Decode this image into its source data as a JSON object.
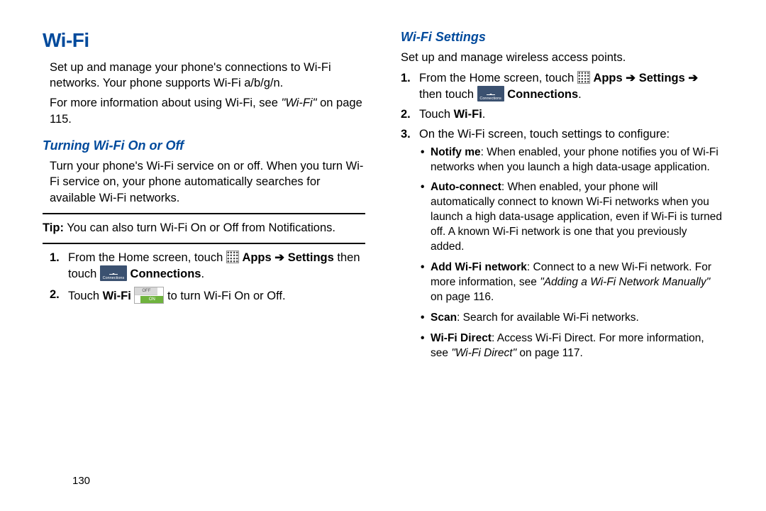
{
  "left": {
    "title": "Wi-Fi",
    "intro1": "Set up and manage your phone's connections to Wi-Fi networks. Your phone supports Wi-Fi a/b/g/n.",
    "intro2a": "For more information about using Wi-Fi, see ",
    "intro2b": "\"Wi-Fi\"",
    "intro2c": " on page 115.",
    "subhead": "Turning Wi-Fi On or Off",
    "turn_intro": "Turn your phone's Wi-Fi service on or off. When you turn Wi-Fi service on, your phone automatically searches for available Wi-Fi networks.",
    "tip_label": "Tip:",
    "tip_text": " You can also turn Wi-Fi On or Off from Notifications.",
    "step1a": "From the Home screen, touch ",
    "apps": " Apps ",
    "arrow": "➔",
    "step1b": " Settings",
    "step1c": " then touch ",
    "connections": " Connections",
    "step2a": "Touch ",
    "wifi_b": "Wi-Fi",
    "step2b": " to turn Wi-Fi On or Off.",
    "off": "OFF",
    "on": "ON"
  },
  "right": {
    "subhead": "Wi-Fi Settings",
    "intro": "Set up and manage wireless access points.",
    "step1a": "From the Home screen, touch ",
    "apps": " Apps ",
    "arrow": "➔",
    "settings": " Settings ",
    "step1b": "then touch ",
    "connections": " Connections",
    "step2a": "Touch ",
    "wifi_b": "Wi-Fi",
    "step3": "On the Wi-Fi screen, touch settings to configure:",
    "b1_label": "Notify me",
    "b1_text": ": When enabled, your phone notifies you of Wi-Fi networks when you launch a high data-usage application.",
    "b2_label": "Auto-connect",
    "b2_text": ": When enabled, your phone will automatically connect to known Wi-Fi networks when you launch a high data-usage application, even if Wi-Fi is turned off. A known Wi-Fi network is one that you previously added.",
    "b3_label": "Add Wi-Fi network",
    "b3_text_a": ": Connect to a new Wi-Fi network. For more information, see ",
    "b3_ref": "\"Adding a Wi-Fi Network Manually\"",
    "b3_text_b": " on page 116.",
    "b4_label": "Scan",
    "b4_text": ": Search for available Wi-Fi networks.",
    "b5_label": "Wi-Fi Direct",
    "b5_text_a": ": Access Wi-Fi Direct. For more information, see ",
    "b5_ref": "\"Wi-Fi Direct\"",
    "b5_text_b": " on page 117."
  },
  "page_number": "130"
}
